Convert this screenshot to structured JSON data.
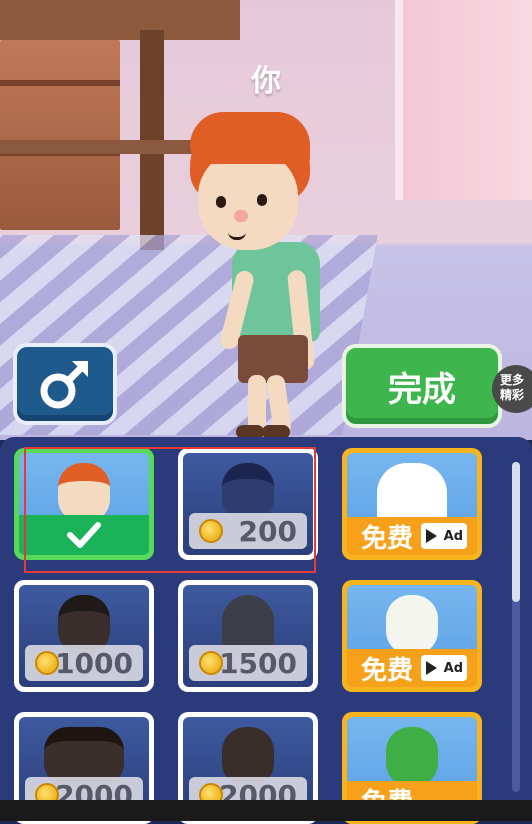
{
  "scene": {
    "player_tag": "你"
  },
  "buttons": {
    "gender_icon": "male-symbol-icon",
    "done_label": "完成",
    "more_label_line1": "更多",
    "more_label_line2": "精彩"
  },
  "shop": {
    "items": [
      {
        "id": "boy",
        "state": "owned-selected"
      },
      {
        "id": "police",
        "price": "200"
      },
      {
        "id": "goose",
        "free_label": "免费",
        "ad_label": "Ad"
      },
      {
        "id": "pirate",
        "price": "1000"
      },
      {
        "id": "knight",
        "price": "1500"
      },
      {
        "id": "skeleton",
        "free_label": "免费",
        "ad_label": "Ad"
      },
      {
        "id": "cowboy",
        "price": "2000"
      },
      {
        "id": "bearded",
        "price": "2000"
      },
      {
        "id": "alien",
        "free_label": "免费"
      }
    ]
  },
  "colors": {
    "panel": "#2a3a7a",
    "selected_border": "#57d95a",
    "ad_border": "#f7b41c",
    "done_button": "#3fb54e",
    "gender_button": "#1f5a8d"
  }
}
